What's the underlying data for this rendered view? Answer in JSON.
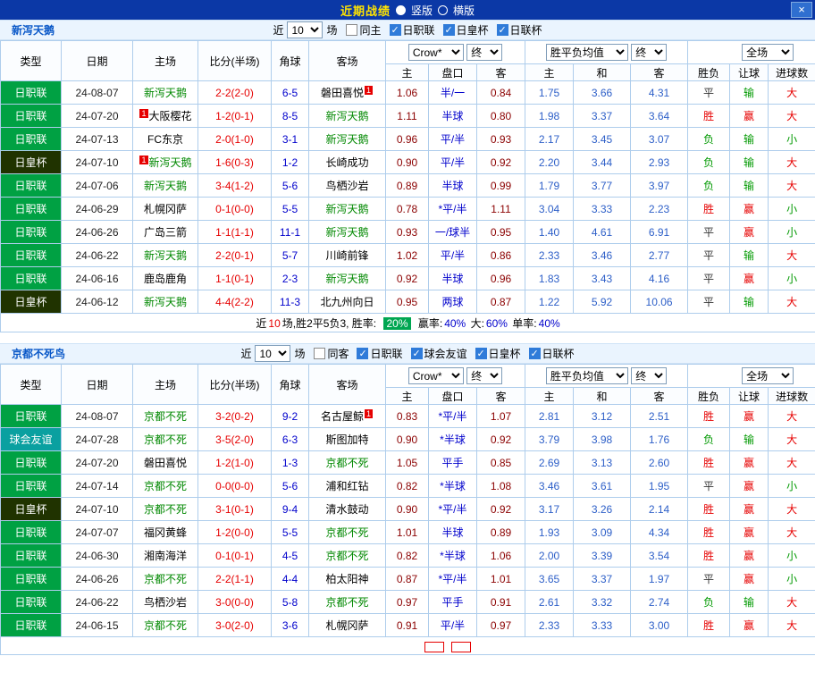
{
  "titlebar": {
    "title": "近期战绩",
    "portrait_label": "竖版",
    "landscape_label": "横版",
    "close_label": "×"
  },
  "controls": {
    "near_label": "近",
    "count_value": "10",
    "games_label": "场",
    "odds_source_value": "Crow*",
    "final_label": "终",
    "euro_source_value": "胜平负均值",
    "scope_value": "全场"
  },
  "columns": {
    "type": "类型",
    "date": "日期",
    "home": "主场",
    "score": "比分(半场)",
    "corners": "角球",
    "away": "客场",
    "handicap_home": "主",
    "handicap": "盘口",
    "handicap_away": "客",
    "euro_home": "主",
    "euro_draw": "和",
    "euro_away": "客",
    "result": "胜负",
    "handicap_result": "让球",
    "goals": "进球数"
  },
  "teams": [
    {
      "name": "新泻天鹅",
      "filters": [
        {
          "label": "同主",
          "checked": false
        },
        {
          "label": "日职联",
          "checked": true
        },
        {
          "label": "日皇杯",
          "checked": true
        },
        {
          "label": "日联杯",
          "checked": true
        }
      ],
      "rows": [
        {
          "league": "日职联",
          "date": "24-08-07",
          "home": "新泻天鹅",
          "home_subject": true,
          "score": "2-2(2-0)",
          "corners": "6-5",
          "away": "磐田喜悦",
          "away_badge": "1",
          "away_badge_pos": "after",
          "odds_home": "1.06",
          "handicap": "半/一",
          "odds_away": "0.84",
          "euro_home": "1.75",
          "euro_draw": "3.66",
          "euro_away": "4.31",
          "result": "平",
          "handicap_result": "输",
          "goals": "大"
        },
        {
          "league": "日职联",
          "date": "24-07-20",
          "home": "大阪樱花",
          "home_badge": "1",
          "home_badge_pos": "before",
          "score": "1-2(0-1)",
          "corners": "8-5",
          "away": "新泻天鹅",
          "away_subject": true,
          "odds_home": "1.11",
          "handicap": "半球",
          "odds_away": "0.80",
          "euro_home": "1.98",
          "euro_draw": "3.37",
          "euro_away": "3.64",
          "result": "胜",
          "handicap_result": "赢",
          "goals": "大"
        },
        {
          "league": "日职联",
          "date": "24-07-13",
          "home": "FC东京",
          "score": "2-0(1-0)",
          "corners": "3-1",
          "away": "新泻天鹅",
          "away_subject": true,
          "odds_home": "0.96",
          "handicap": "平/半",
          "odds_away": "0.93",
          "euro_home": "2.17",
          "euro_draw": "3.45",
          "euro_away": "3.07",
          "result": "负",
          "handicap_result": "输",
          "goals": "小"
        },
        {
          "league": "日皇杯",
          "date": "24-07-10",
          "home": "新泻天鹅",
          "home_subject": true,
          "home_badge": "1",
          "home_badge_pos": "before",
          "score": "1-6(0-3)",
          "corners": "1-2",
          "away": "长崎成功",
          "odds_home": "0.90",
          "handicap": "平/半",
          "odds_away": "0.92",
          "euro_home": "2.20",
          "euro_draw": "3.44",
          "euro_away": "2.93",
          "result": "负",
          "handicap_result": "输",
          "goals": "大"
        },
        {
          "league": "日职联",
          "date": "24-07-06",
          "home": "新泻天鹅",
          "home_subject": true,
          "score": "3-4(1-2)",
          "corners": "5-6",
          "away": "鸟栖沙岩",
          "odds_home": "0.89",
          "handicap": "半球",
          "odds_away": "0.99",
          "euro_home": "1.79",
          "euro_draw": "3.77",
          "euro_away": "3.97",
          "result": "负",
          "handicap_result": "输",
          "goals": "大"
        },
        {
          "league": "日职联",
          "date": "24-06-29",
          "home": "札幌冈萨",
          "score": "0-1(0-0)",
          "corners": "5-5",
          "away": "新泻天鹅",
          "away_subject": true,
          "odds_home": "0.78",
          "handicap": "*平/半",
          "odds_away": "1.11",
          "euro_home": "3.04",
          "euro_draw": "3.33",
          "euro_away": "2.23",
          "result": "胜",
          "handicap_result": "赢",
          "goals": "小"
        },
        {
          "league": "日职联",
          "date": "24-06-26",
          "home": "广岛三箭",
          "score": "1-1(1-1)",
          "corners": "11-1",
          "away": "新泻天鹅",
          "away_subject": true,
          "odds_home": "0.93",
          "handicap": "一/球半",
          "odds_away": "0.95",
          "euro_home": "1.40",
          "euro_draw": "4.61",
          "euro_away": "6.91",
          "result": "平",
          "handicap_result": "赢",
          "goals": "小"
        },
        {
          "league": "日职联",
          "date": "24-06-22",
          "home": "新泻天鹅",
          "home_subject": true,
          "score": "2-2(0-1)",
          "corners": "5-7",
          "away": "川崎前锋",
          "odds_home": "1.02",
          "handicap": "平/半",
          "odds_away": "0.86",
          "euro_home": "2.33",
          "euro_draw": "3.46",
          "euro_away": "2.77",
          "result": "平",
          "handicap_result": "输",
          "goals": "大"
        },
        {
          "league": "日职联",
          "date": "24-06-16",
          "home": "鹿岛鹿角",
          "score": "1-1(0-1)",
          "corners": "2-3",
          "away": "新泻天鹅",
          "away_subject": true,
          "odds_home": "0.92",
          "handicap": "半球",
          "odds_away": "0.96",
          "euro_home": "1.83",
          "euro_draw": "3.43",
          "euro_away": "4.16",
          "result": "平",
          "handicap_result": "赢",
          "goals": "小"
        },
        {
          "league": "日皇杯",
          "date": "24-06-12",
          "home": "新泻天鹅",
          "home_subject": true,
          "score": "4-4(2-2)",
          "corners": "11-3",
          "away": "北九州向日",
          "odds_home": "0.95",
          "handicap": "两球",
          "odds_away": "0.87",
          "euro_home": "1.22",
          "euro_draw": "5.92",
          "euro_away": "10.06",
          "result": "平",
          "handicap_result": "输",
          "goals": "大"
        }
      ],
      "summary": {
        "near": "近",
        "count": "10",
        "text": "场,胜2平5负3, 胜率:",
        "win_rate": "20%",
        "label_win": "赢率:",
        "value_win": "40%",
        "label_big": "大:",
        "value_big": "60%",
        "label_single": "单率:",
        "value_single": "40%"
      }
    },
    {
      "name": "京都不死鸟",
      "filters": [
        {
          "label": "同客",
          "checked": false
        },
        {
          "label": "日职联",
          "checked": true
        },
        {
          "label": "球会友谊",
          "checked": true
        },
        {
          "label": "日皇杯",
          "checked": true
        },
        {
          "label": "日联杯",
          "checked": true
        }
      ],
      "rows": [
        {
          "league": "日职联",
          "date": "24-08-07",
          "home": "京都不死",
          "home_subject": true,
          "score": "3-2(0-2)",
          "corners": "9-2",
          "away": "名古屋鲸",
          "away_badge": "1",
          "away_badge_pos": "after",
          "odds_home": "0.83",
          "handicap": "*平/半",
          "odds_away": "1.07",
          "euro_home": "2.81",
          "euro_draw": "3.12",
          "euro_away": "2.51",
          "result": "胜",
          "handicap_result": "赢",
          "goals": "大"
        },
        {
          "league": "球会友谊",
          "date": "24-07-28",
          "home": "京都不死",
          "home_subject": true,
          "score": "3-5(2-0)",
          "corners": "6-3",
          "away": "斯图加特",
          "odds_home": "0.90",
          "handicap": "*半球",
          "odds_away": "0.92",
          "euro_home": "3.79",
          "euro_draw": "3.98",
          "euro_away": "1.76",
          "result": "负",
          "handicap_result": "输",
          "goals": "大"
        },
        {
          "league": "日职联",
          "date": "24-07-20",
          "home": "磐田喜悦",
          "score": "1-2(1-0)",
          "corners": "1-3",
          "away": "京都不死",
          "away_subject": true,
          "odds_home": "1.05",
          "handicap": "平手",
          "odds_away": "0.85",
          "euro_home": "2.69",
          "euro_draw": "3.13",
          "euro_away": "2.60",
          "result": "胜",
          "handicap_result": "赢",
          "goals": "大"
        },
        {
          "league": "日职联",
          "date": "24-07-14",
          "home": "京都不死",
          "home_subject": true,
          "score": "0-0(0-0)",
          "corners": "5-6",
          "away": "浦和红钻",
          "odds_home": "0.82",
          "handicap": "*半球",
          "odds_away": "1.08",
          "euro_home": "3.46",
          "euro_draw": "3.61",
          "euro_away": "1.95",
          "result": "平",
          "handicap_result": "赢",
          "goals": "小"
        },
        {
          "league": "日皇杯",
          "date": "24-07-10",
          "home": "京都不死",
          "home_subject": true,
          "score": "3-1(0-1)",
          "corners": "9-4",
          "away": "清水鼓动",
          "odds_home": "0.90",
          "handicap": "*平/半",
          "odds_away": "0.92",
          "euro_home": "3.17",
          "euro_draw": "3.26",
          "euro_away": "2.14",
          "result": "胜",
          "handicap_result": "赢",
          "goals": "大"
        },
        {
          "league": "日职联",
          "date": "24-07-07",
          "home": "福冈黄蜂",
          "score": "1-2(0-0)",
          "corners": "5-5",
          "away": "京都不死",
          "away_subject": true,
          "odds_home": "1.01",
          "handicap": "半球",
          "odds_away": "0.89",
          "euro_home": "1.93",
          "euro_draw": "3.09",
          "euro_away": "4.34",
          "result": "胜",
          "handicap_result": "赢",
          "goals": "大"
        },
        {
          "league": "日职联",
          "date": "24-06-30",
          "home": "湘南海洋",
          "score": "0-1(0-1)",
          "corners": "4-5",
          "away": "京都不死",
          "away_subject": true,
          "odds_home": "0.82",
          "handicap": "*半球",
          "odds_away": "1.06",
          "euro_home": "2.00",
          "euro_draw": "3.39",
          "euro_away": "3.54",
          "result": "胜",
          "handicap_result": "赢",
          "goals": "小"
        },
        {
          "league": "日职联",
          "date": "24-06-26",
          "home": "京都不死",
          "home_subject": true,
          "score": "2-2(1-1)",
          "corners": "4-4",
          "away": "柏太阳神",
          "odds_home": "0.87",
          "handicap": "*平/半",
          "odds_away": "1.01",
          "euro_home": "3.65",
          "euro_draw": "3.37",
          "euro_away": "1.97",
          "result": "平",
          "handicap_result": "赢",
          "goals": "小"
        },
        {
          "league": "日职联",
          "date": "24-06-22",
          "home": "鸟栖沙岩",
          "score": "3-0(0-0)",
          "corners": "5-8",
          "away": "京都不死",
          "away_subject": true,
          "odds_home": "0.97",
          "handicap": "平手",
          "odds_away": "0.91",
          "euro_home": "2.61",
          "euro_draw": "3.32",
          "euro_away": "2.74",
          "result": "负",
          "handicap_result": "输",
          "goals": "大"
        },
        {
          "league": "日职联",
          "date": "24-06-15",
          "home": "京都不死",
          "home_subject": true,
          "score": "3-0(2-0)",
          "corners": "3-6",
          "away": "札幌冈萨",
          "odds_home": "0.91",
          "handicap": "平/半",
          "odds_away": "0.97",
          "euro_home": "2.33",
          "euro_draw": "3.33",
          "euro_away": "3.00",
          "result": "胜",
          "handicap_result": "赢",
          "goals": "大"
        }
      ]
    }
  ]
}
